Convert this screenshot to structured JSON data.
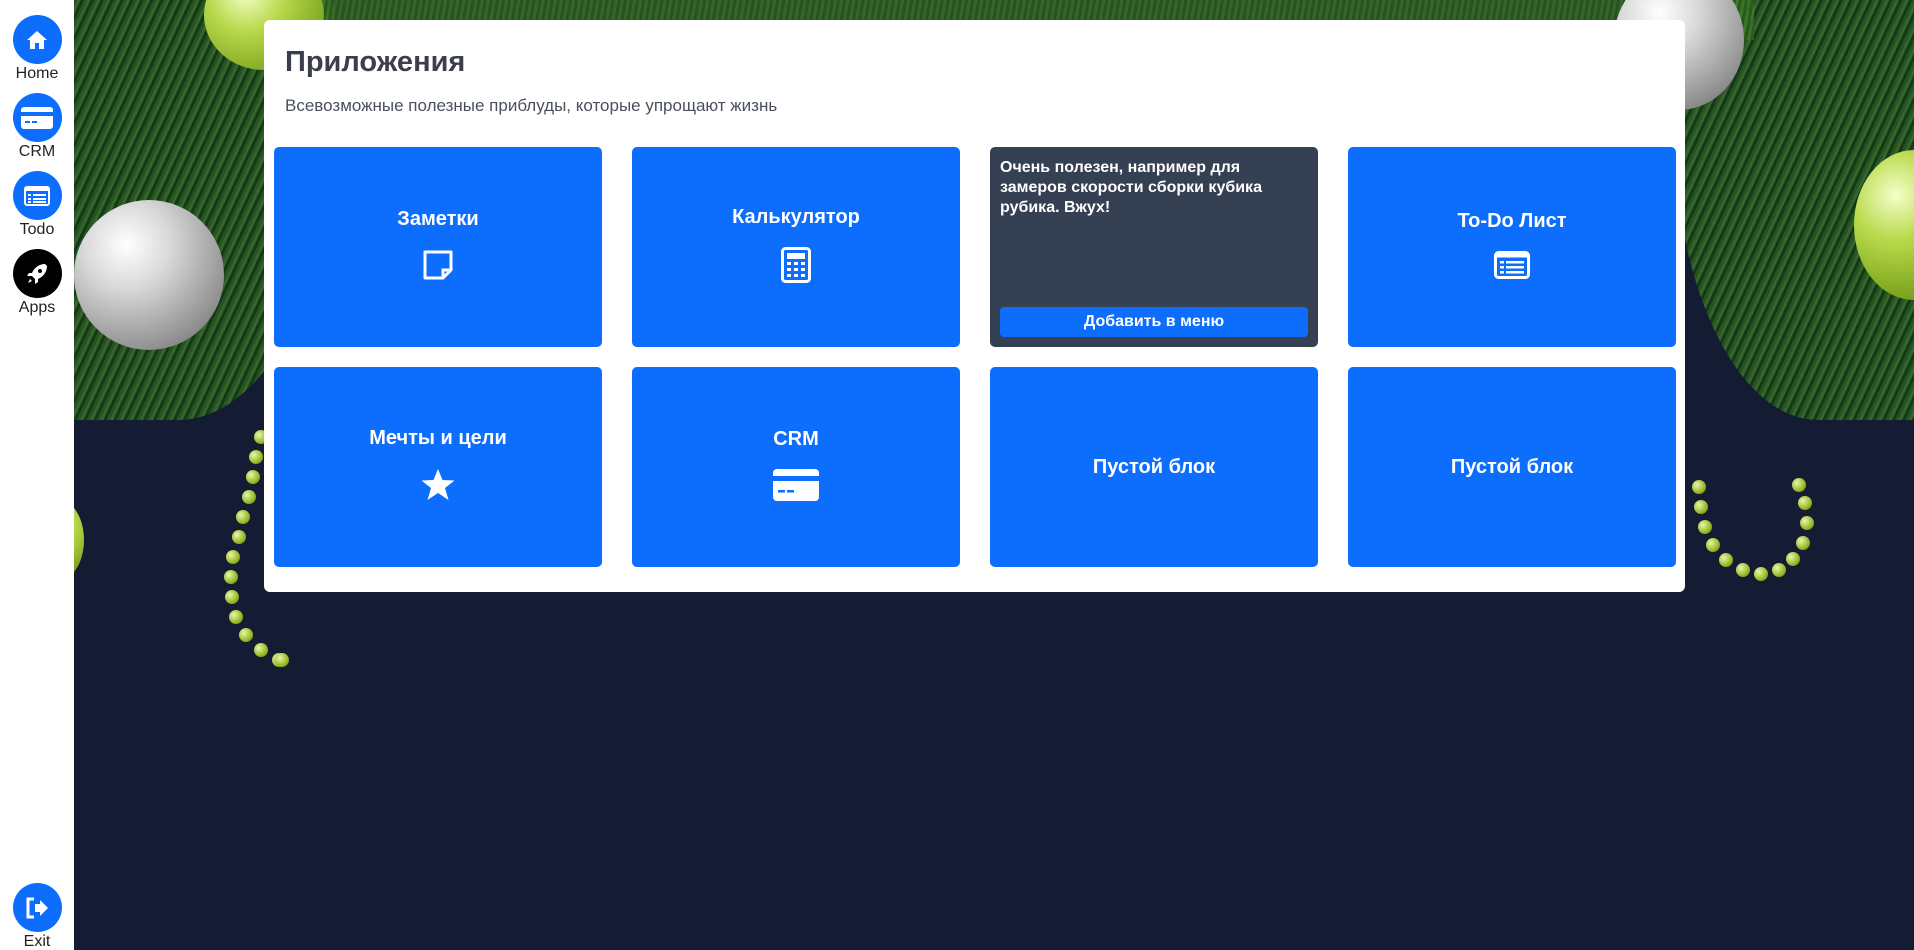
{
  "sidebar": {
    "items": [
      {
        "label": "Home",
        "icon": "home-icon"
      },
      {
        "label": "CRM",
        "icon": "credit-card-icon"
      },
      {
        "label": "Todo",
        "icon": "list-icon"
      },
      {
        "label": "Apps",
        "icon": "rocket-icon"
      }
    ],
    "exit": {
      "label": "Exit",
      "icon": "sign-out-icon"
    }
  },
  "panel": {
    "title": "Приложения",
    "subtitle": "Всевозможные полезные приблуды, которые упрощают жизнь"
  },
  "cards": [
    {
      "title": "Заметки",
      "icon": "sticky-note-icon"
    },
    {
      "title": "Калькулятор",
      "icon": "calculator-icon"
    },
    {
      "description": "Очень полезен, например для замеров скорости сборки кубика рубика. Вжух!",
      "button": "Добавить в меню"
    },
    {
      "title": "To-Do Лист",
      "icon": "list-icon"
    },
    {
      "title": "Мечты и цели",
      "icon": "star-icon"
    },
    {
      "title": "CRM",
      "icon": "credit-card-icon"
    },
    {
      "title": "Пустой блок"
    },
    {
      "title": "Пустой блок"
    }
  ],
  "colors": {
    "accent": "#0d6efd",
    "background": "#131c33",
    "dark_card": "#354052",
    "apps_active": "#000000"
  }
}
